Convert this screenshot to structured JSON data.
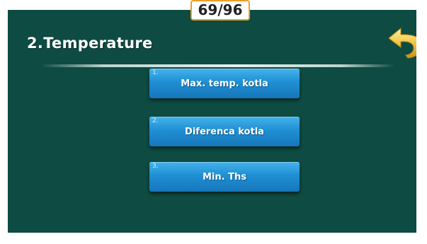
{
  "header": {
    "title": "2.Temperature",
    "page_counter": "69/96"
  },
  "back_button": {
    "icon": "back-arrow-icon",
    "color": "#f2c84b"
  },
  "menu": {
    "items": [
      {
        "number": "1.",
        "label": "Max. temp. kotla"
      },
      {
        "number": "2.",
        "label": "Diferenca kotla"
      },
      {
        "number": "3.",
        "label": "Min. Ths"
      }
    ]
  },
  "colors": {
    "background": "#0e4b42",
    "button": "#1f8fd4",
    "counter_border": "#e7a02a"
  }
}
